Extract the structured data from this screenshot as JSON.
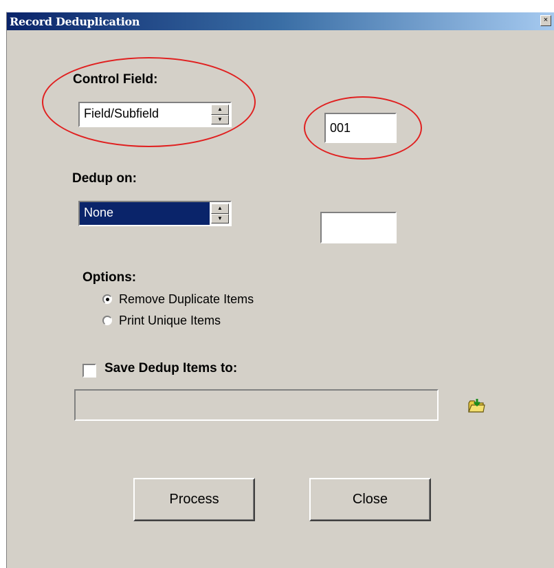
{
  "window": {
    "title": "Record Deduplication",
    "close_glyph": "×"
  },
  "control_field": {
    "label": "Control Field:",
    "selected": "Field/Subfield",
    "value": "001"
  },
  "dedup_on": {
    "label": "Dedup on:",
    "selected": "None",
    "value": ""
  },
  "options": {
    "label": "Options:",
    "items": [
      {
        "label": "Remove Duplicate Items",
        "checked": true
      },
      {
        "label": "Print Unique Items",
        "checked": false
      }
    ]
  },
  "save": {
    "label": "Save Dedup Items to:",
    "checked": false,
    "path": ""
  },
  "buttons": {
    "process": "Process",
    "close": "Close"
  },
  "colors": {
    "annotation": "#e02020",
    "titlebar_start": "#0a246a",
    "selection": "#0a246a",
    "dialog_bg": "#d4d0c8"
  },
  "icons": {
    "spin_up": "▲",
    "spin_down": "▼",
    "browse": "folder-open-icon"
  }
}
